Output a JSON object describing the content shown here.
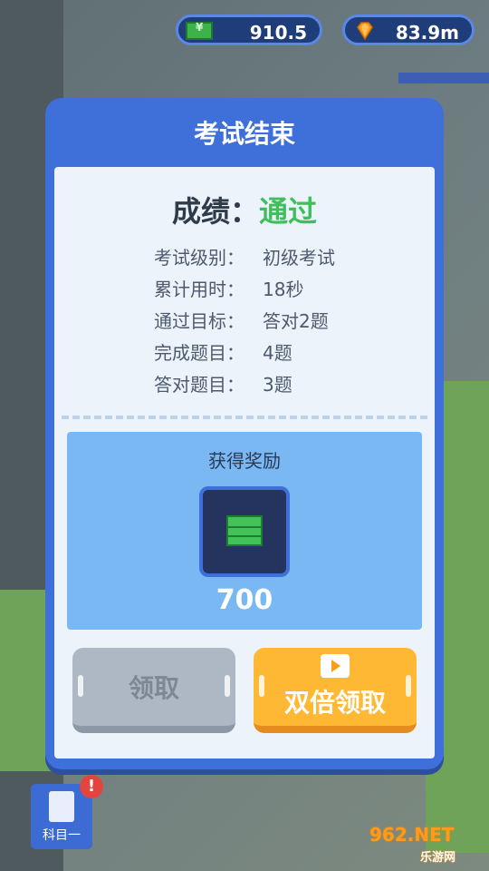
{
  "currency": {
    "cash": "910.5",
    "gems": "83.9m"
  },
  "modal": {
    "title": "考试结束",
    "score_label": "成绩：",
    "score_value": "通过",
    "info": [
      {
        "k": "考试级别：",
        "v": "初级考试"
      },
      {
        "k": "累计用时：",
        "v": "18秒"
      },
      {
        "k": "通过目标：",
        "v": "答对2题"
      },
      {
        "k": "完成题目：",
        "v": "4题"
      },
      {
        "k": "答对题目：",
        "v": "3题"
      }
    ],
    "reward_title": "获得奖励",
    "reward_amount": "700",
    "btn_claim": "领取",
    "btn_double": "双倍领取"
  },
  "subject": {
    "label": "科目一",
    "alert": "!"
  },
  "watermark": {
    "brand": "962.NET",
    "sub": "乐游网"
  },
  "colors": {
    "primary": "#3f6fd8",
    "pass": "#3fbf5a",
    "orange": "#ffb833"
  }
}
